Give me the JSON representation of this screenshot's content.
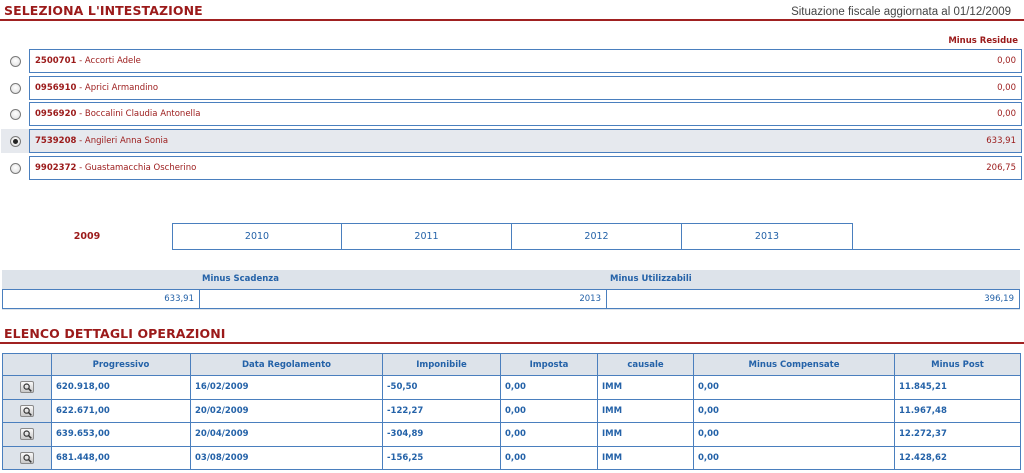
{
  "header": {
    "title": "SELEZIONA L'INTESTAZIONE",
    "status": "Situazione fiscale aggiornata al 01/12/2009",
    "column_label": "Minus Residue"
  },
  "accounts": [
    {
      "code": "2500701",
      "name": " - Accorti Adele",
      "value": "0,00",
      "selected": false
    },
    {
      "code": "0956910",
      "name": " - Aprici Armandino",
      "value": "0,00",
      "selected": false
    },
    {
      "code": "0956920",
      "name": " - Boccalini Claudia Antonella",
      "value": "0,00",
      "selected": false
    },
    {
      "code": "7539208",
      "name": " - Angileri Anna Sonia",
      "value": "633,91",
      "selected": true
    },
    {
      "code": "9902372",
      "name": " - Guastamacchia Oscherino",
      "value": "206,75",
      "selected": false
    }
  ],
  "tabs": [
    "2009",
    "2010",
    "2011",
    "2012",
    "2013"
  ],
  "active_tab": "2009",
  "summary": {
    "minus_scadenza_label": "Minus Scadenza",
    "minus_utilizzabili_label": "Minus Utilizzabili",
    "scadenza_value": "633,91",
    "year_value": "2013",
    "utilizzabili_value": "396,19"
  },
  "details": {
    "title": "ELENCO DETTAGLI OPERAZIONI",
    "columns": [
      "Progressivo",
      "Data Regolamento",
      "Imponibile",
      "Imposta",
      "causale",
      "Minus Compensate",
      "Minus Post"
    ],
    "rows": [
      [
        "620.918,00",
        "16/02/2009",
        "-50,50",
        "0,00",
        "IMM",
        "0,00",
        "11.845,21"
      ],
      [
        "622.671,00",
        "20/02/2009",
        "-122,27",
        "0,00",
        "IMM",
        "0,00",
        "11.967,48"
      ],
      [
        "639.653,00",
        "20/04/2009",
        "-304,89",
        "0,00",
        "IMM",
        "0,00",
        "12.272,37"
      ],
      [
        "681.448,00",
        "03/08/2009",
        "-156,25",
        "0,00",
        "IMM",
        "0,00",
        "12.428,62"
      ]
    ]
  },
  "colors": {
    "brand_red": "#9b1a1a",
    "link_blue": "#2462a8",
    "border_blue": "#4a7fbe"
  }
}
